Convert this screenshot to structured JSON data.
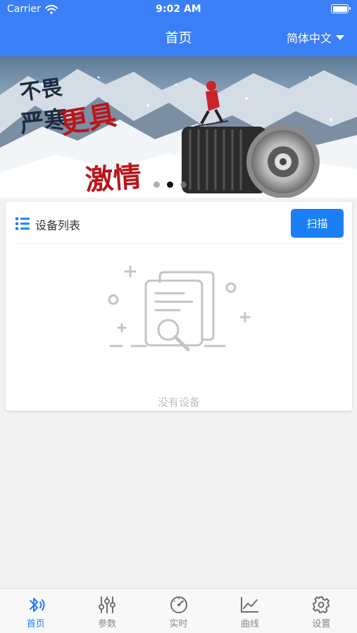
{
  "status_bar": {
    "carrier": "Carrier",
    "time": "9:02 AM"
  },
  "nav": {
    "title": "首页",
    "language": "简体中文"
  },
  "banner": {
    "slogan_lines": [
      "不畏",
      "严寒",
      "更具",
      "激情"
    ],
    "active_slide": 2,
    "slide_count": 3
  },
  "device_list": {
    "title": "设备列表",
    "scan_label": "扫描",
    "empty_text": "没有设备"
  },
  "tabbar": {
    "active": "home",
    "tabs": [
      {
        "id": "home",
        "label": "首页",
        "icon": "bluetooth-icon"
      },
      {
        "id": "params",
        "label": "参数",
        "icon": "sliders-icon"
      },
      {
        "id": "realtime",
        "label": "实时",
        "icon": "gauge-icon"
      },
      {
        "id": "curve",
        "label": "曲线",
        "icon": "line-chart-icon"
      },
      {
        "id": "settings",
        "label": "设置",
        "icon": "gear-icon"
      }
    ]
  },
  "colors": {
    "primary": "#3a7ff6",
    "button": "#1a7ff5",
    "muted": "#8a8a8a"
  }
}
